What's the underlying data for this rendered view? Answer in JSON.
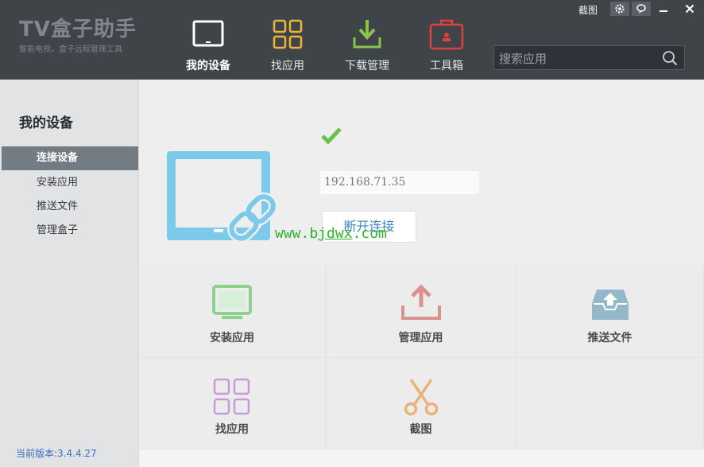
{
  "header": {
    "logo_title": "TV盒子助手",
    "logo_subtitle": "智能电视，盒子远程管理工具",
    "nav": [
      {
        "label": "我的设备",
        "icon": "tv-icon",
        "active": true
      },
      {
        "label": "找应用",
        "icon": "grid-apps-icon",
        "active": false
      },
      {
        "label": "下载管理",
        "icon": "download-icon",
        "active": false
      },
      {
        "label": "工具箱",
        "icon": "toolbox-icon",
        "active": false
      }
    ],
    "search": {
      "placeholder": "搜索应用"
    },
    "window": {
      "screenshot_label": "截图"
    }
  },
  "sidebar": {
    "title": "我的设备",
    "items": [
      {
        "label": "连接设备",
        "active": true
      },
      {
        "label": "安装应用",
        "active": false
      },
      {
        "label": "推送文件",
        "active": false
      },
      {
        "label": "管理盒子",
        "active": false
      }
    ],
    "version": "当前版本:3.4.4.27"
  },
  "device": {
    "ip": "192.168.71.35",
    "disconnect_label": "断开连接",
    "watermark_a": "www.b",
    "watermark_b": "jdwx",
    "watermark_c": ".com"
  },
  "actions": [
    {
      "label": "安装应用",
      "icon": "monitor-icon",
      "color": "#8fd28f"
    },
    {
      "label": "管理应用",
      "icon": "upload-icon",
      "color": "#d9928e"
    },
    {
      "label": "推送文件",
      "icon": "inbox-upload-icon",
      "color": "#93b8c9"
    },
    {
      "label": "找应用",
      "icon": "grid-icon",
      "color": "#c79ad9"
    },
    {
      "label": "截图",
      "icon": "scissors-icon",
      "color": "#e9b37a"
    }
  ],
  "colors": {
    "header_bg": "#3f4449",
    "sidebar_active": "#737b83",
    "accent_blue": "#3d86cc",
    "device_blue": "#7ccaea",
    "check_green": "#6cbf4a"
  }
}
